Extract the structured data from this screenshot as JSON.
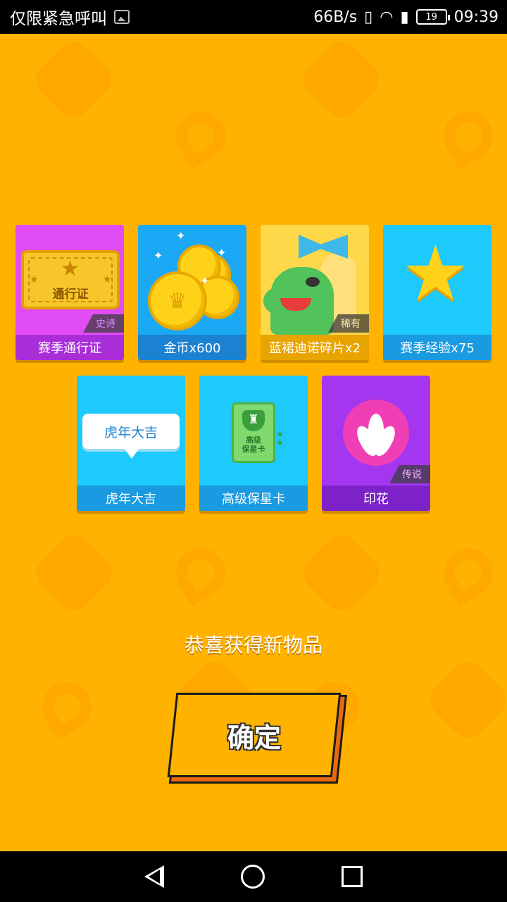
{
  "status_bar": {
    "left_text": "仅限紧急呼叫",
    "speed": "66B/s",
    "battery": "19",
    "time": "09:39"
  },
  "items_row1": [
    {
      "label": "赛季通行证",
      "rarity": "史诗",
      "icon": "ticket-icon"
    },
    {
      "label": "金币x600",
      "rarity": "",
      "icon": "coins-icon"
    },
    {
      "label": "蓝裙迪诺碎片x2",
      "rarity": "稀有",
      "icon": "dino-icon"
    },
    {
      "label": "赛季经验x75",
      "rarity": "",
      "icon": "star-icon"
    }
  ],
  "items_row2": [
    {
      "label": "虎年大吉",
      "rarity": "",
      "icon": "speech-bubble-icon",
      "bubble_text": "虎年大吉"
    },
    {
      "label": "高级保星卡",
      "rarity": "",
      "icon": "shield-card-icon",
      "card_text": "高级\n保星卡"
    },
    {
      "label": "印花",
      "rarity": "传说",
      "icon": "flower-stamp-icon"
    }
  ],
  "ticket_text": "通行证",
  "congrats_text": "恭喜获得新物品",
  "confirm_label": "确定",
  "colors": {
    "background": "#ffb300",
    "epic": "#a92ed8",
    "blue": "#1a82d0",
    "legend": "#7d22c8"
  }
}
